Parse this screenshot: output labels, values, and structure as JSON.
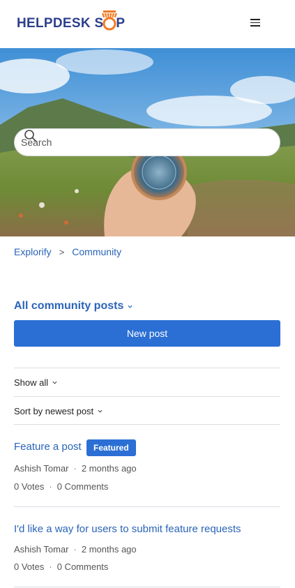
{
  "header": {
    "logo_part1": "HELPDESK S",
    "logo_part2": "P",
    "menu_icon": "hamburger-icon",
    "brand_color": "#2c3e8c",
    "accent_color": "#f07a22"
  },
  "search": {
    "placeholder": "Search",
    "value": ""
  },
  "breadcrumb": {
    "items": [
      "Explorify",
      "Community"
    ],
    "separator": ">"
  },
  "topic": {
    "title": "All community posts"
  },
  "actions": {
    "new_post_label": "New post",
    "button_color": "#2b6fd4"
  },
  "filters": {
    "show": "Show all",
    "sort": "Sort by newest post"
  },
  "posts": [
    {
      "title": "Feature a post",
      "badge": "Featured",
      "author": "Ashish Tomar",
      "time": "2 months ago",
      "votes": "0 Votes",
      "comments": "0 Comments"
    },
    {
      "title": "I'd like a way for users to submit feature requests",
      "author": "Ashish Tomar",
      "time": "2 months ago",
      "votes": "0 Votes",
      "comments": "0 Comments"
    }
  ]
}
